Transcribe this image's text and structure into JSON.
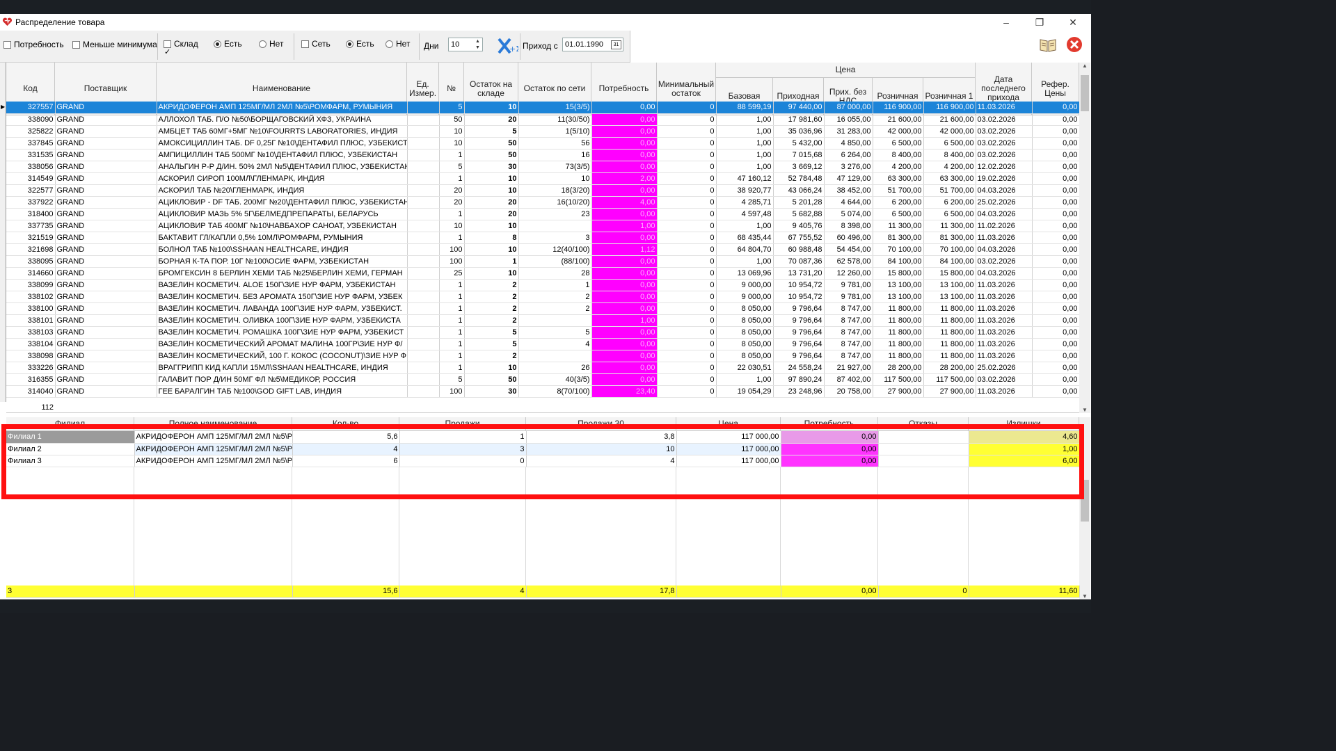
{
  "window": {
    "title": "Распределение товара"
  },
  "toolbar": {
    "need_label": "Потребность",
    "less_min_label": "Меньше минимума",
    "stock_label": "Склад",
    "stock_yes": "Есть",
    "stock_no": "Нет",
    "net_label": "Сеть",
    "net_yes": "Есть",
    "net_no": "Нет",
    "days_label": "Дни",
    "days_value": "10",
    "arrival_label": "Приход с",
    "arrival_date": "01.01.1990",
    "calendar_label": "31"
  },
  "main_grid": {
    "headers": {
      "code": "Код",
      "supplier": "Поставщик",
      "name": "Наименование",
      "unit": "Ед. Измер.",
      "num": "№",
      "stock_wh": "Остаток на складе",
      "stock_net": "Остаток по сети",
      "need": "Потребность",
      "min_stock": "Минимальный остаток",
      "price_group": "Цена",
      "base": "Базовая",
      "incoming": "Приходная",
      "incoming_novat": "Прих. без НДС",
      "retail": "Розничная",
      "retail1": "Розничная 1",
      "last_arrival": "Дата последнего прихода",
      "ref_price": "Рефер. Цены"
    },
    "rows": [
      [
        "327557",
        "GRAND",
        "АКРИДОФЕРОН АМП 125МГ/МЛ 2МЛ №5\\РОМФАРМ, РУМЫНИЯ",
        "",
        "5",
        "10",
        "15(3/5)",
        "0,00",
        "0",
        "88 599,19",
        "97 440,00",
        "87 000,00",
        "116 900,00",
        "116 900,00",
        "11.03.2026",
        "0,00"
      ],
      [
        "338090",
        "GRAND",
        "АЛЛОХОЛ ТАБ. П/О №50\\БОРЩАГОВСКИЙ ХФЗ, УКРАИНА",
        "",
        "50",
        "20",
        "11(30/50)",
        "0,00",
        "0",
        "1,00",
        "17 981,60",
        "16 055,00",
        "21 600,00",
        "21 600,00",
        "03.02.2026",
        "0,00"
      ],
      [
        "325822",
        "GRAND",
        "АМБЦЕТ ТАБ 60МГ+5МГ №10\\FOURRTS LABORATORIES, ИНДИЯ",
        "",
        "10",
        "5",
        "1(5/10)",
        "0,00",
        "0",
        "1,00",
        "35 036,96",
        "31 283,00",
        "42 000,00",
        "42 000,00",
        "03.02.2026",
        "0,00"
      ],
      [
        "337845",
        "GRAND",
        "АМОКСИЦИЛЛИН ТАБ. DF 0,25Г №10\\ДЕНТАФИЛ ПЛЮС, УЗБЕКИСТ.",
        "",
        "10",
        "50",
        "56",
        "0,00",
        "0",
        "1,00",
        "5 432,00",
        "4 850,00",
        "6 500,00",
        "6 500,00",
        "03.02.2026",
        "0,00"
      ],
      [
        "331535",
        "GRAND",
        "АМПИЦИЛЛИН ТАБ 500МГ №10\\ДЕНТАФИЛ ПЛЮС, УЗБЕКИСТАН",
        "",
        "1",
        "50",
        "16",
        "0,00",
        "0",
        "1,00",
        "7 015,68",
        "6 264,00",
        "8 400,00",
        "8 400,00",
        "03.02.2026",
        "0,00"
      ],
      [
        "338056",
        "GRAND",
        "АНАЛЬГИН Р-Р Д/ИН. 50% 2МЛ №5\\ДЕНТАФИЛ ПЛЮС, УЗБЕКИСТАН",
        "",
        "5",
        "30",
        "73(3/5)",
        "0,00",
        "0",
        "1,00",
        "3 669,12",
        "3 276,00",
        "4 200,00",
        "4 200,00",
        "12.02.2026",
        "0,00"
      ],
      [
        "314549",
        "GRAND",
        "АСКОРИЛ СИРОП 100МЛ\\ГЛЕНМАРК, ИНДИЯ",
        "",
        "1",
        "10",
        "10",
        "2,00",
        "0",
        "47 160,12",
        "52 784,48",
        "47 129,00",
        "63 300,00",
        "63 300,00",
        "19.02.2026",
        "0,00"
      ],
      [
        "322577",
        "GRAND",
        "АСКОРИЛ ТАБ №20\\ГЛЕНМАРК, ИНДИЯ",
        "",
        "20",
        "10",
        "18(3/20)",
        "0,00",
        "0",
        "38 920,77",
        "43 066,24",
        "38 452,00",
        "51 700,00",
        "51 700,00",
        "04.03.2026",
        "0,00"
      ],
      [
        "337922",
        "GRAND",
        "АЦИКЛОВИР - DF ТАБ. 200МГ №20\\ДЕНТАФИЛ ПЛЮС, УЗБЕКИСТАН",
        "",
        "20",
        "20",
        "16(10/20)",
        "4,00",
        "0",
        "4 285,71",
        "5 201,28",
        "4 644,00",
        "6 200,00",
        "6 200,00",
        "25.02.2026",
        "0,00"
      ],
      [
        "318400",
        "GRAND",
        "АЦИКЛОВИР МАЗЬ 5% 5Г\\БЕЛМЕДПРЕПАРАТЫ, БЕЛАРУСЬ",
        "",
        "1",
        "20",
        "23",
        "0,00",
        "0",
        "4 597,48",
        "5 682,88",
        "5 074,00",
        "6 500,00",
        "6 500,00",
        "04.03.2026",
        "0,00"
      ],
      [
        "337735",
        "GRAND",
        "АЦИКЛОВИР ТАБ 400МГ №10\\НАВБАХОР САНОАТ, УЗБЕКИСТАН",
        "",
        "10",
        "10",
        "",
        "1,00",
        "0",
        "1,00",
        "9 405,76",
        "8 398,00",
        "11 300,00",
        "11 300,00",
        "11.02.2026",
        "0,00"
      ],
      [
        "321519",
        "GRAND",
        "БАКТАВИТ ГЛ/КАПЛИ 0,5% 10МЛ\\РОМФАРМ, РУМЫНИЯ",
        "",
        "1",
        "8",
        "3",
        "0,00",
        "0",
        "68 435,44",
        "67 755,52",
        "60 496,00",
        "81 300,00",
        "81 300,00",
        "11.03.2026",
        "0,00"
      ],
      [
        "321698",
        "GRAND",
        "БОЛНОЛ ТАБ №100\\SSHAAN HEALTHCARE, ИНДИЯ",
        "",
        "100",
        "10",
        "12(40/100)",
        "1,12",
        "0",
        "64 804,70",
        "60 988,48",
        "54 454,00",
        "70 100,00",
        "70 100,00",
        "04.03.2026",
        "0,00"
      ],
      [
        "338095",
        "GRAND",
        "БОРНАЯ К-ТА ПОР. 10Г №100\\ОСИЕ ФАРМ, УЗБЕКИСТАН",
        "",
        "100",
        "1",
        "(88/100)",
        "0,00",
        "0",
        "1,00",
        "70 087,36",
        "62 578,00",
        "84 100,00",
        "84 100,00",
        "03.02.2026",
        "0,00"
      ],
      [
        "314660",
        "GRAND",
        "БРОМГЕКСИН 8 БЕРЛИН ХЕМИ ТАБ №25\\БЕРЛИН ХЕМИ, ГЕРМАН",
        "",
        "25",
        "10",
        "28",
        "0,00",
        "0",
        "13 069,96",
        "13 731,20",
        "12 260,00",
        "15 800,00",
        "15 800,00",
        "04.03.2026",
        "0,00"
      ],
      [
        "338099",
        "GRAND",
        "ВАЗЕЛИН КОСМЕТИЧ. ALOE 150Г\\ЗИЕ НУР ФАРМ, УЗБЕКИСТАН",
        "",
        "1",
        "2",
        "1",
        "0,00",
        "0",
        "9 000,00",
        "10 954,72",
        "9 781,00",
        "13 100,00",
        "13 100,00",
        "11.03.2026",
        "0,00"
      ],
      [
        "338102",
        "GRAND",
        "ВАЗЕЛИН КОСМЕТИЧ. БЕЗ АРОМАТА 150Г\\ЗИЕ НУР ФАРМ, УЗБЕК",
        "",
        "1",
        "2",
        "2",
        "0,00",
        "0",
        "9 000,00",
        "10 954,72",
        "9 781,00",
        "13 100,00",
        "13 100,00",
        "11.03.2026",
        "0,00"
      ],
      [
        "338100",
        "GRAND",
        "ВАЗЕЛИН КОСМЕТИЧ. ЛАВАНДА 100Г\\ЗИЕ НУР ФАРМ, УЗБЕКИСТ.",
        "",
        "1",
        "2",
        "2",
        "0,00",
        "0",
        "8 050,00",
        "9 796,64",
        "8 747,00",
        "11 800,00",
        "11 800,00",
        "11.03.2026",
        "0,00"
      ],
      [
        "338101",
        "GRAND",
        "ВАЗЕЛИН КОСМЕТИЧ. ОЛИВКА 100Г\\ЗИЕ НУР ФАРМ, УЗБЕКИСТА",
        "",
        "1",
        "2",
        "",
        "1,00",
        "0",
        "8 050,00",
        "9 796,64",
        "8 747,00",
        "11 800,00",
        "11 800,00",
        "11.03.2026",
        "0,00"
      ],
      [
        "338103",
        "GRAND",
        "ВАЗЕЛИН КОСМЕТИЧ. РОМАШКА 100Г\\ЗИЕ НУР ФАРМ, УЗБЕКИСТ",
        "",
        "1",
        "5",
        "5",
        "0,00",
        "0",
        "8 050,00",
        "9 796,64",
        "8 747,00",
        "11 800,00",
        "11 800,00",
        "11.03.2026",
        "0,00"
      ],
      [
        "338104",
        "GRAND",
        "ВАЗЕЛИН КОСМЕТИЧЕСКИЙ АРОМАТ МАЛИНА 100ГР\\ЗИЕ НУР Ф/",
        "",
        "1",
        "5",
        "4",
        "0,00",
        "0",
        "8 050,00",
        "9 796,64",
        "8 747,00",
        "11 800,00",
        "11 800,00",
        "11.03.2026",
        "0,00"
      ],
      [
        "338098",
        "GRAND",
        "ВАЗЕЛИН КОСМЕТИЧЕСКИЙ, 100 Г. КОКОС (COCONUT)\\ЗИЕ НУР Ф",
        "",
        "1",
        "2",
        "",
        "0,00",
        "0",
        "8 050,00",
        "9 796,64",
        "8 747,00",
        "11 800,00",
        "11 800,00",
        "11.03.2026",
        "0,00"
      ],
      [
        "333226",
        "GRAND",
        "ВРАГГРИПП КИД КАПЛИ 15МЛ\\SSHAAN HEALTHCARE, ИНДИЯ",
        "",
        "1",
        "10",
        "26",
        "0,00",
        "0",
        "22 030,51",
        "24 558,24",
        "21 927,00",
        "28 200,00",
        "28 200,00",
        "25.02.2026",
        "0,00"
      ],
      [
        "316355",
        "GRAND",
        "ГАЛАВИТ ПОР Д/ИН 50МГ ФЛ №5\\МЕДИКОР, РОССИЯ",
        "",
        "5",
        "50",
        "40(3/5)",
        "0,00",
        "0",
        "1,00",
        "97 890,24",
        "87 402,00",
        "117 500,00",
        "117 500,00",
        "03.02.2026",
        "0,00"
      ],
      [
        "314040",
        "GRAND",
        "ГЕЕ БАРАЛГИН ТАБ №100\\GOD GIFT LAB, ИНДИЯ",
        "",
        "100",
        "30",
        "8(70/100)",
        "23,40",
        "0",
        "19 054,29",
        "23 248,96",
        "20 758,00",
        "27 900,00",
        "27 900,00",
        "11.03.2026",
        "0,00"
      ]
    ],
    "footer_count": "112"
  },
  "detail_grid": {
    "headers": {
      "branch": "Филиал",
      "full_name": "Полное наименование",
      "qty": "Кол-во",
      "sales": "Продажи",
      "sales30": "Продажи 30",
      "price": "Цена",
      "need": "Потребность",
      "refusals": "Отказы",
      "surplus": "Излишки"
    },
    "rows": [
      [
        "Филиал 1",
        "АКРИДОФЕРОН АМП 125МГ/МЛ 2МЛ №5\\Р(",
        "5,6",
        "1",
        "3,8",
        "117 000,00",
        "0,00",
        "",
        "4,60"
      ],
      [
        "Филиал 2",
        "АКРИДОФЕРОН АМП 125МГ/МЛ 2МЛ №5\\Р(",
        "4",
        "3",
        "10",
        "117 000,00",
        "0,00",
        "",
        "1,00"
      ],
      [
        "Филиал 3",
        "АКРИДОФЕРОН АМП 125МГ/МЛ 2МЛ №5\\Р(",
        "6",
        "0",
        "4",
        "117 000,00",
        "0,00",
        "",
        "6,00"
      ]
    ],
    "totals": [
      "3",
      "",
      "15,6",
      "4",
      "17,8",
      "",
      "0,00",
      "0",
      "11,60"
    ]
  },
  "colors": {
    "selection": "#1c84d8",
    "need_highlight": "#ff00ff",
    "surplus_highlight": "#ffff33",
    "callout_border": "#ff1010"
  }
}
